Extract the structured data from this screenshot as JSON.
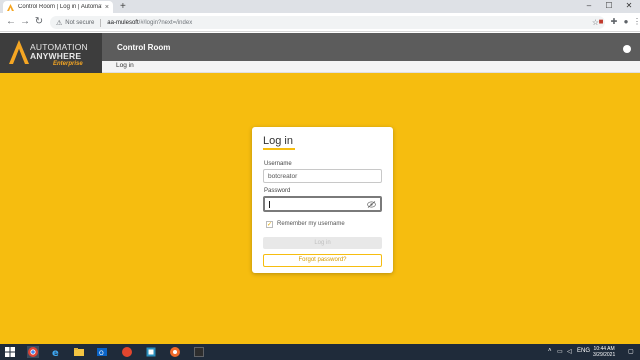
{
  "browser": {
    "tab_title": "Control Room | Log in | Automation Anywhere",
    "tab_close": "×",
    "new_tab": "+",
    "security_label": "Not secure",
    "url_host": "aa-mulesoft",
    "url_path": "/#/login?next=/index",
    "window_controls": [
      "–",
      "☐",
      "✕"
    ]
  },
  "app": {
    "brand_line1": "AUTOMATION",
    "brand_line2": "ANYWHERE",
    "brand_line3": "Enterprise",
    "title": "Control Room",
    "breadcrumb": "Log in"
  },
  "login": {
    "heading": "Log in",
    "username_label": "Username",
    "username_value": "botcreator",
    "password_label": "Password",
    "password_value": "",
    "remember_label": "Remember my username",
    "remember_checked": true,
    "login_button": "Log in",
    "forgot_button": "Forgot password?"
  },
  "taskbar": {
    "language": "ENG",
    "time": "10:44 AM",
    "date": "3/29/2021"
  },
  "colors": {
    "accent": "#f6bd0f",
    "header": "#5c5c5c",
    "brand_bg": "#3d3d3d",
    "brand_orange": "#f5a623",
    "taskbar": "#1f2b3a"
  }
}
